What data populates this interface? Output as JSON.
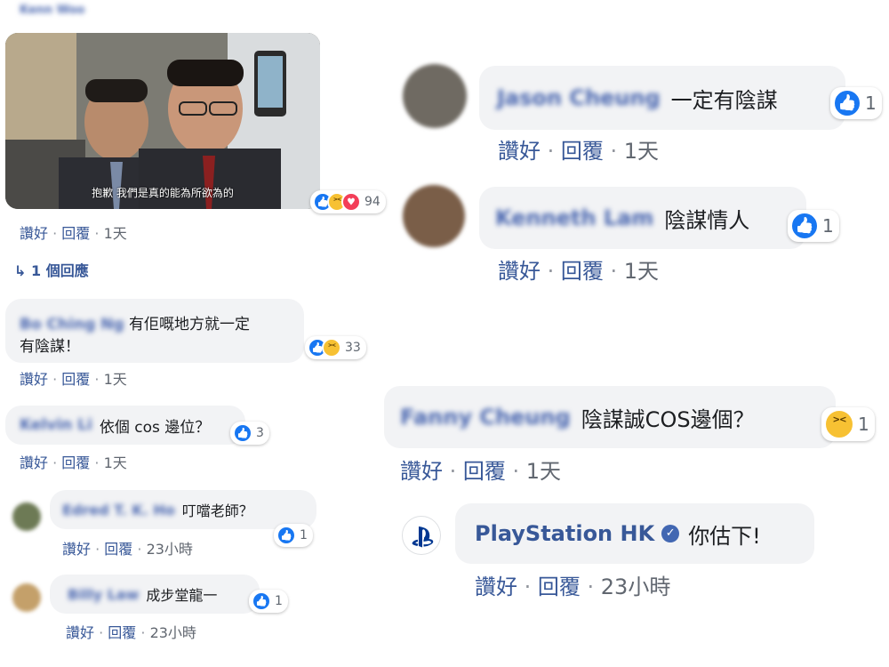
{
  "header_blurred": "Kenn Woo",
  "thread": {
    "reactions_count": "94",
    "actions": {
      "like": "讚好",
      "reply": "回覆",
      "time": "1天"
    },
    "replies_link": "1 個回應",
    "photo_caption": "抱歉 我們是真的能為所欲為的"
  },
  "left_comments": [
    {
      "name": "Bo Ching Ng",
      "text_line1": "有佢嘅地方就一定",
      "text_line2": "有陰謀！",
      "reactions_count": "33",
      "like": "讚好",
      "reply": "回覆",
      "time": "1天"
    },
    {
      "name": "Kelvin Li",
      "text": "依個 cos 邊位？",
      "reactions_count": "3",
      "like": "讚好",
      "reply": "回覆",
      "time": "1天"
    },
    {
      "name": "Edred T. K. Ho",
      "text": "叮噹老師？",
      "reactions_count": "1",
      "like": "讚好",
      "reply": "回覆",
      "time": "23小時"
    },
    {
      "name": "Billy Law",
      "text": "成步堂龍一",
      "reactions_count": "1",
      "like": "讚好",
      "reply": "回覆",
      "time": "23小時"
    }
  ],
  "right_comments": [
    {
      "name": "Jason Cheung",
      "text": "一定有陰謀",
      "reactions_count": "1",
      "like": "讚好",
      "reply": "回覆",
      "time": "1天"
    },
    {
      "name": "Kenneth Lam",
      "text": "陰謀情人",
      "reactions_count": "1",
      "like": "讚好",
      "reply": "回覆",
      "time": "1天"
    },
    {
      "name": "Fanny Cheung",
      "text": "陰謀誠COS邊個？",
      "reactions_count": "1",
      "like": "讚好",
      "reply": "回覆",
      "time": "1天"
    }
  ],
  "playstation_reply": {
    "name": "PlayStation HK",
    "text": "你估下!",
    "like": "讚好",
    "reply": "回覆",
    "time": "23小時"
  },
  "colors": {
    "bubble": "#f2f3f5",
    "link": "#385898",
    "like_blue": "#1877f2",
    "haha_yellow": "#f7c133",
    "love_red": "#f33e58",
    "ps_blue": "#003791"
  }
}
